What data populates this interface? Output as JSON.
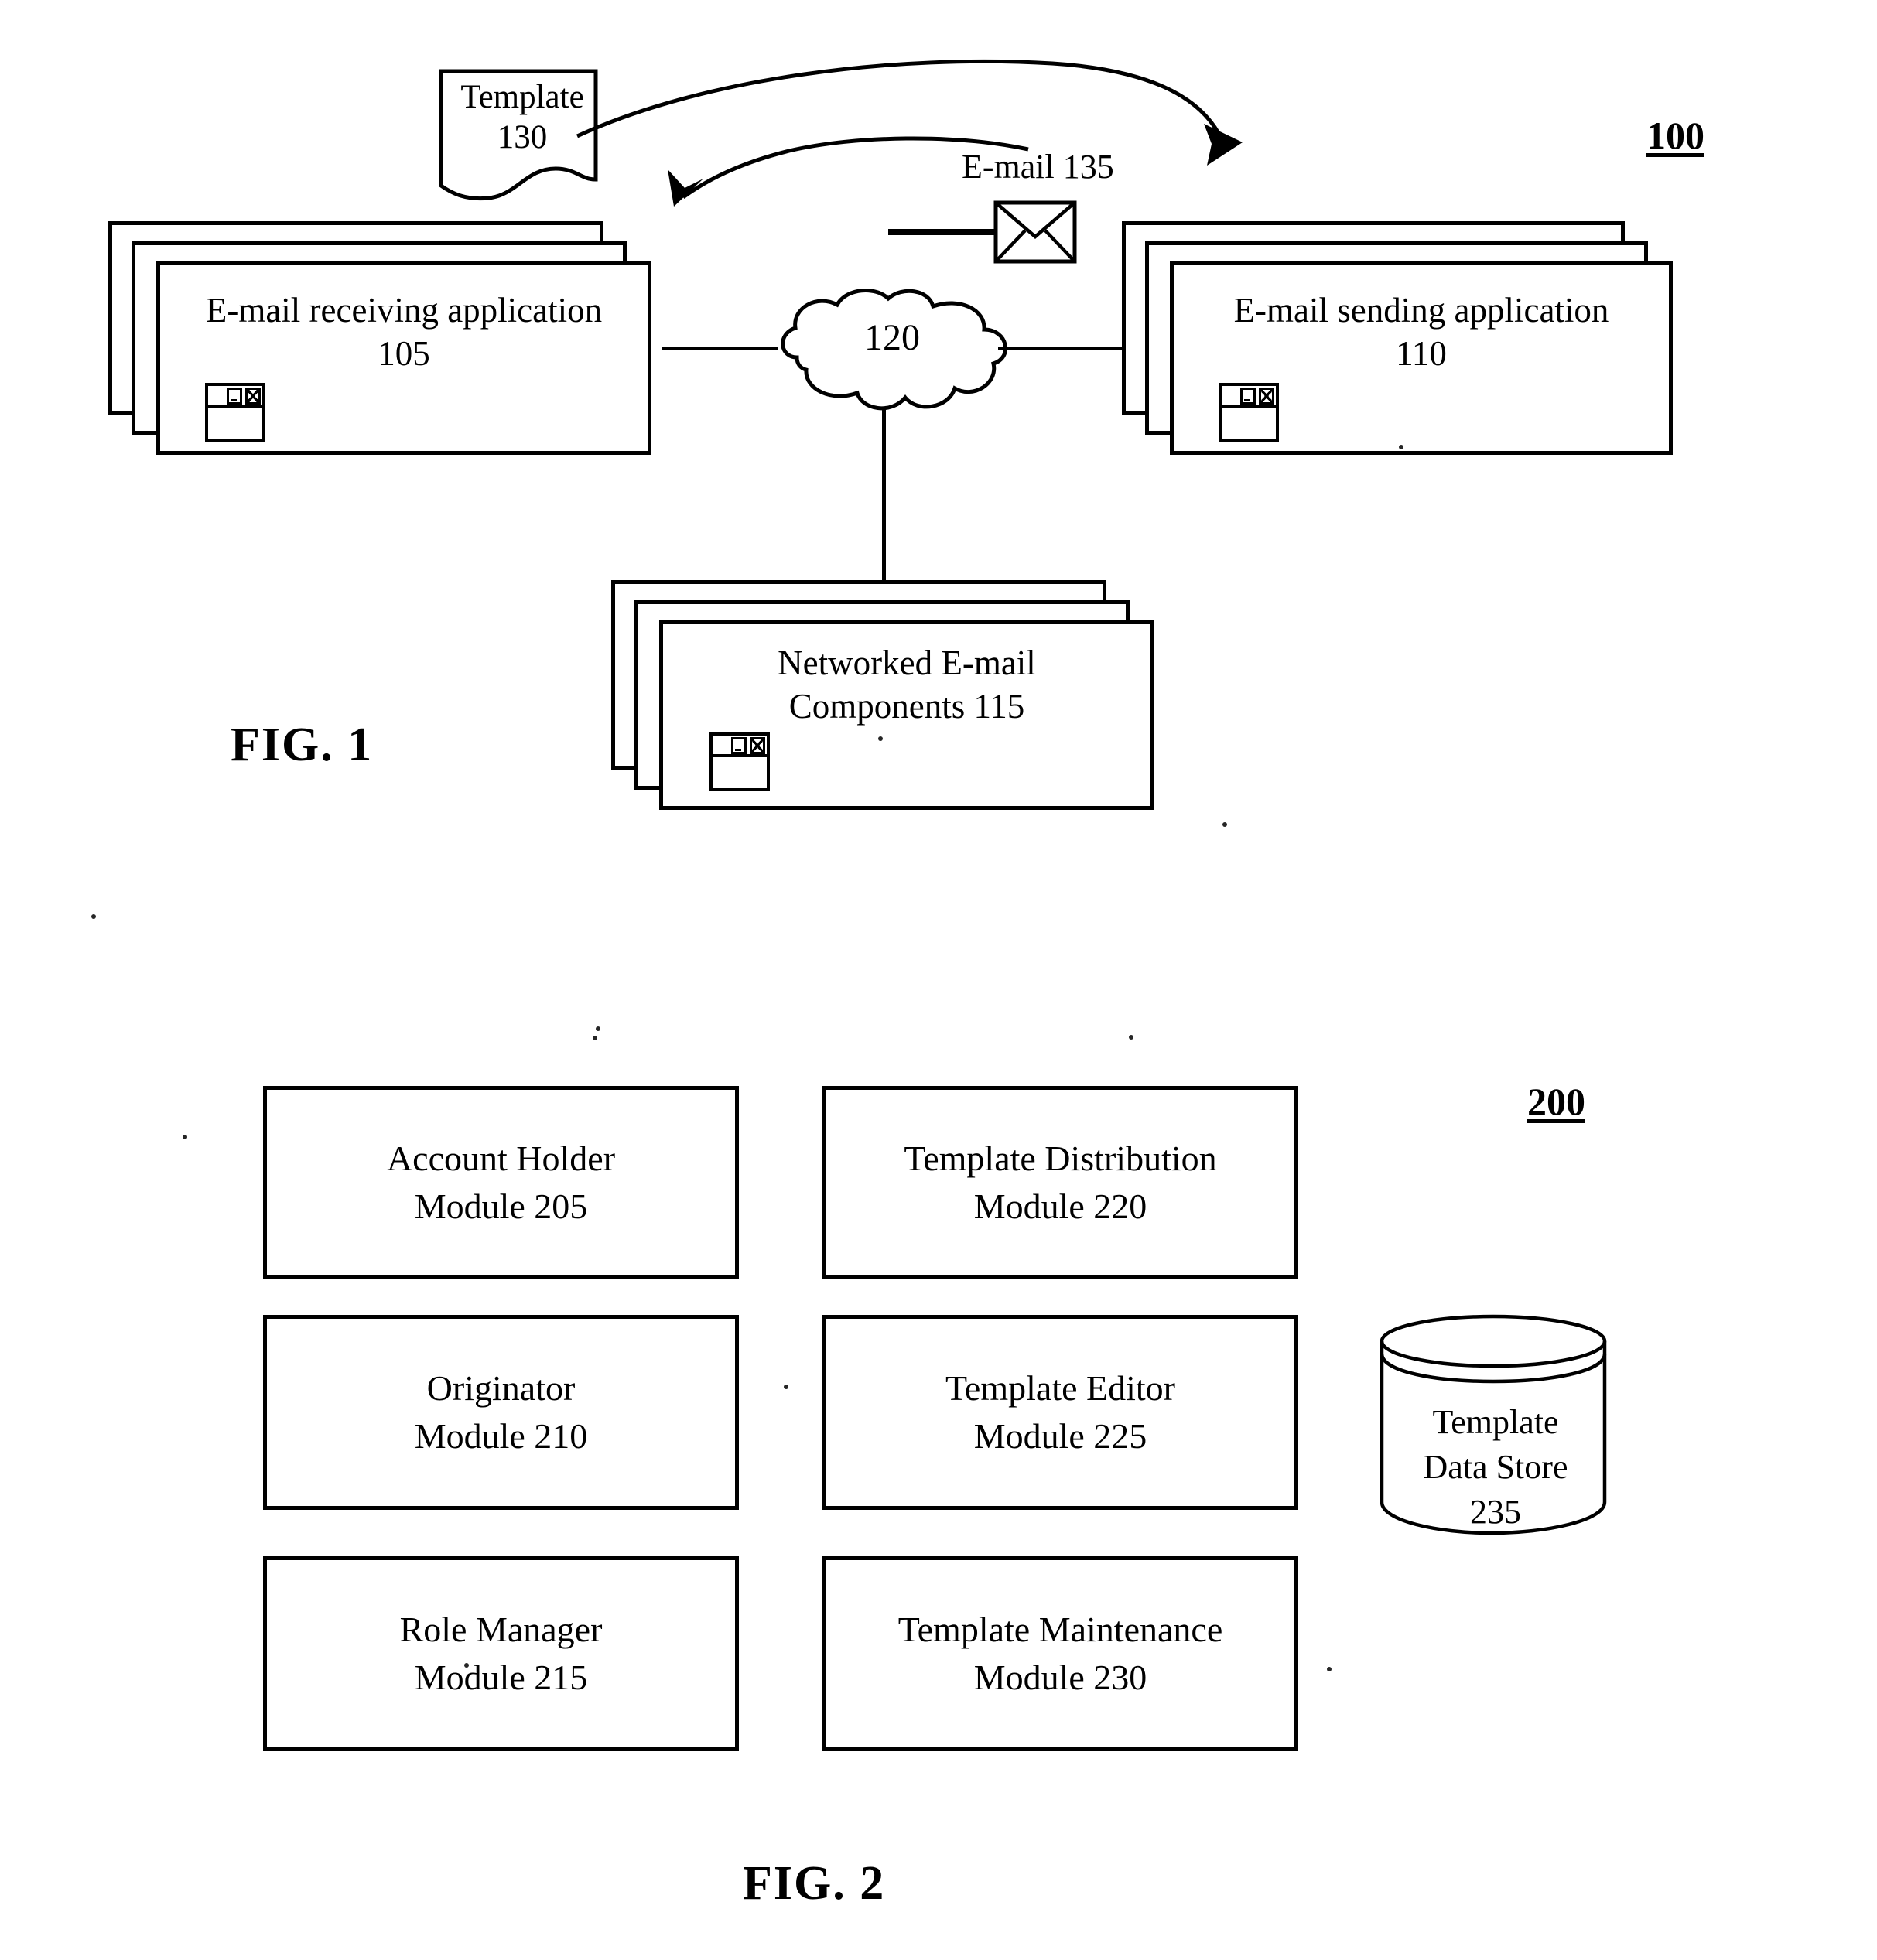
{
  "figure1": {
    "reference_numeral": "100",
    "caption": "FIG. 1",
    "template_doc": {
      "line1": "Template",
      "line2": "130"
    },
    "email_icon_label": "E-mail 135",
    "receiving_app": {
      "line1": "E-mail receiving application",
      "line2": "105",
      "window_icon": "window-icon"
    },
    "sending_app": {
      "line1": "E-mail sending application",
      "line2": "110",
      "window_icon": "window-icon"
    },
    "network_cloud": {
      "label": "120"
    },
    "networked_components": {
      "line1": "Networked E-mail",
      "line2": "Components 115",
      "window_icon": "window-icon"
    }
  },
  "figure2": {
    "reference_numeral": "200",
    "caption": "FIG. 2",
    "modules": [
      {
        "id": "account-holder",
        "line1": "Account Holder",
        "line2": "Module 205"
      },
      {
        "id": "template-distribution",
        "line1": "Template Distribution",
        "line2": "Module 220"
      },
      {
        "id": "originator",
        "line1": "Originator",
        "line2": "Module 210"
      },
      {
        "id": "template-editor",
        "line1": "Template Editor",
        "line2": "Module 225"
      },
      {
        "id": "role-manager",
        "line1": "Role Manager",
        "line2": "Module 215"
      },
      {
        "id": "template-maintenance",
        "line1": "Template Maintenance",
        "line2": "Module 230"
      }
    ],
    "data_store": {
      "line1": "Template",
      "line2": "Data Store",
      "line3": "235"
    }
  },
  "colors": {
    "ink": "#000000",
    "paper": "#ffffff"
  }
}
